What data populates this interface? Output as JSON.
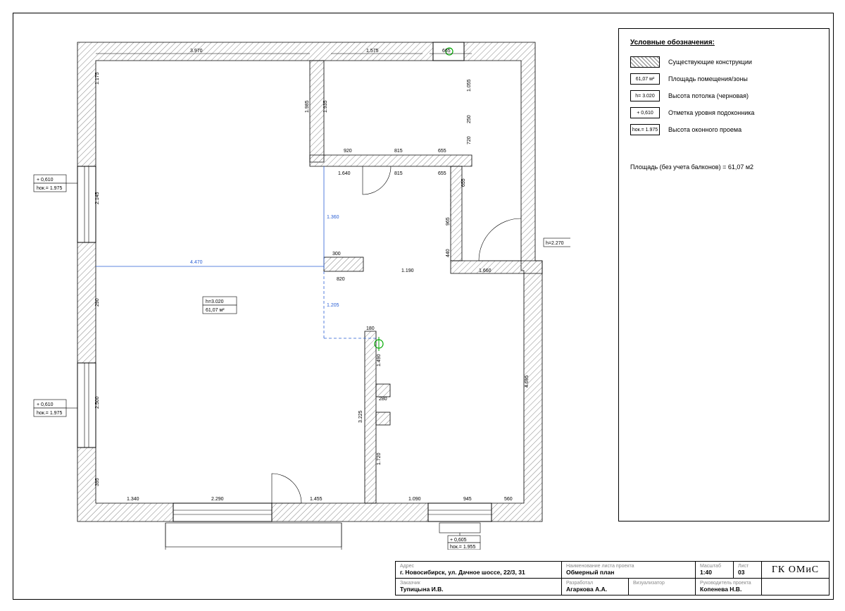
{
  "legend": {
    "title": "Условные обозначения:",
    "items": [
      {
        "sample": "",
        "type": "hatch",
        "label": "Существующие конструкции"
      },
      {
        "sample": "61,07 м²",
        "type": "box",
        "label": "Площадь помещения/зоны"
      },
      {
        "sample": "h= 3.020",
        "type": "box",
        "label": "Высота потолка (черновая)"
      },
      {
        "sample": "+ 0,610",
        "type": "box",
        "label": "Отметка уровня подоконника"
      },
      {
        "sample": "hок.= 1.975",
        "type": "box",
        "label": "Высота оконного проема"
      }
    ],
    "area_note": "Площадь (без учета балконов) = 61,07 м2"
  },
  "titleblock": {
    "address_hdr": "Адрес",
    "address": "г. Новосибирск, ул. Дачное шоссе, 22/3, 31",
    "sheetname_hdr": "Наименование листа проекта",
    "sheetname": "Обмерный план",
    "scale_hdr": "Масштаб",
    "scale": "1:40",
    "sheet_hdr": "Лист",
    "sheet": "03",
    "client_hdr": "Заказчик",
    "client": "Тупицына И.В.",
    "developer_hdr": "Разработал",
    "developer": "Агаркова А.А.",
    "viz_hdr": "Визуализатор",
    "viz": "",
    "lead_hdr": "Руководитель проекта",
    "lead": "Копенева Н.В.",
    "logo": "ГК ОМиС"
  },
  "tags": {
    "ceiling_h": "h=3.020",
    "area": "61,07 м²",
    "win_left1_lvl": "+ 0,610",
    "win_left1_h": "hок.= 1.975",
    "win_left2_lvl": "+ 0,610",
    "win_left2_h": "hок.= 1.975",
    "door_right_h": "h=2.270",
    "win_bot_lvl": "+ 0,605",
    "win_bot_h": "hок.= 1.955"
  },
  "dims": {
    "top_main": "3.970",
    "top_right": "1.575",
    "top_right2": "665",
    "left_1": "1.175",
    "left_span1": "2.145",
    "left_gap1": "290",
    "left_span2": "2.500",
    "left_3": "395",
    "inner_top_h": "1.985",
    "inner_top_h2": "1.935",
    "inner_top_bot1": "920",
    "inner_top_bot2": "815",
    "inner_top_bot3": "655",
    "inner_below1": "1.640",
    "inner_below2": "815",
    "inner_below3": "655",
    "right_col_1": "1.055",
    "right_col_2": "250",
    "right_col_3": "720",
    "right_col_4": "655",
    "right_col_5": "965",
    "right_col_6": "440",
    "right_span": "4.695",
    "col_blue_v1": "1.360",
    "col_blue_v2": "1.205",
    "blue_h": "4.470",
    "pillar_w": "300",
    "pillar_below": "820",
    "pillar_right": "1.190",
    "entry_w": "1.660",
    "partition_w": "180",
    "partition_h1": "1.490",
    "partition_gap": "280",
    "partition_col": "3.225",
    "partition_h2": "1.720",
    "bot_1": "1.340",
    "bot_2": "2.290",
    "bot_3": "1.455",
    "bot_4": "1.090",
    "bot_5": "945",
    "bot_6": "560"
  }
}
